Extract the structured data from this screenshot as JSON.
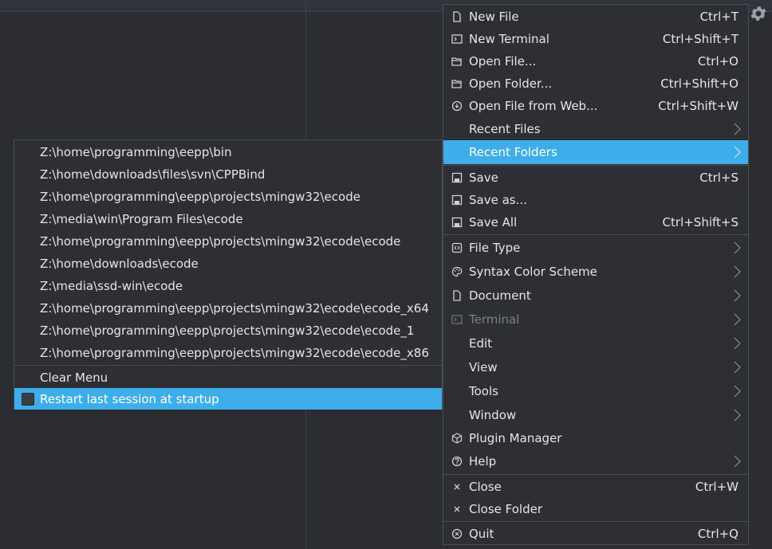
{
  "main_menu": {
    "items": [
      {
        "label": "New File",
        "shortcut": "Ctrl+T",
        "icon": "file-icon"
      },
      {
        "label": "New Terminal",
        "shortcut": "Ctrl+Shift+T",
        "icon": "terminal-icon"
      },
      {
        "label": "Open File...",
        "shortcut": "Ctrl+O",
        "icon": "folder-open-icon"
      },
      {
        "label": "Open Folder...",
        "shortcut": "Ctrl+Shift+O",
        "icon": "folder-open-icon"
      },
      {
        "label": "Open File from Web...",
        "shortcut": "Ctrl+Shift+W",
        "icon": "cloud-download-icon"
      },
      {
        "label": "Recent Files",
        "submenu": true
      },
      {
        "label": "Recent Folders",
        "submenu": true,
        "highlighted": true
      },
      {
        "label": "Save",
        "shortcut": "Ctrl+S",
        "icon": "save-icon"
      },
      {
        "label": "Save as...",
        "icon": "save-icon"
      },
      {
        "label": "Save All",
        "shortcut": "Ctrl+Shift+S",
        "icon": "save-icon"
      },
      {
        "label": "File Type",
        "submenu": true,
        "icon": "file-code-icon"
      },
      {
        "label": "Syntax Color Scheme",
        "submenu": true,
        "icon": "palette-icon"
      },
      {
        "label": "Document",
        "submenu": true,
        "icon": "document-icon"
      },
      {
        "label": "Terminal",
        "submenu": true,
        "icon": "terminal-icon",
        "disabled": true
      },
      {
        "label": "Edit",
        "submenu": true
      },
      {
        "label": "View",
        "submenu": true
      },
      {
        "label": "Tools",
        "submenu": true
      },
      {
        "label": "Window",
        "submenu": true
      },
      {
        "label": "Plugin Manager",
        "icon": "package-icon"
      },
      {
        "label": "Help",
        "submenu": true,
        "icon": "help-icon"
      },
      {
        "label": "Close",
        "shortcut": "Ctrl+W",
        "icon": "close-icon"
      },
      {
        "label": "Close Folder",
        "icon": "close-icon"
      },
      {
        "label": "Quit",
        "shortcut": "Ctrl+Q",
        "icon": "quit-icon"
      }
    ]
  },
  "recent_folders_menu": {
    "items": [
      "Z:\\home\\programming\\eepp\\bin",
      "Z:\\home\\downloads\\files\\svn\\CPPBind",
      "Z:\\home\\programming\\eepp\\projects\\mingw32\\ecode",
      "Z:\\media\\win\\Program Files\\ecode",
      "Z:\\home\\programming\\eepp\\projects\\mingw32\\ecode\\ecode",
      "Z:\\home\\downloads\\ecode",
      "Z:\\media\\ssd-win\\ecode",
      "Z:\\home\\programming\\eepp\\projects\\mingw32\\ecode\\ecode_x64",
      "Z:\\home\\programming\\eepp\\projects\\mingw32\\ecode\\ecode_1",
      "Z:\\home\\programming\\eepp\\projects\\mingw32\\ecode\\ecode_x86"
    ],
    "clear_label": "Clear Menu",
    "restart_label": "Restart last session at startup",
    "restart_checked": false
  },
  "colors": {
    "highlight": "#3daee9",
    "menu_bg": "#2d2f35",
    "window_bg": "#2b2d33"
  }
}
